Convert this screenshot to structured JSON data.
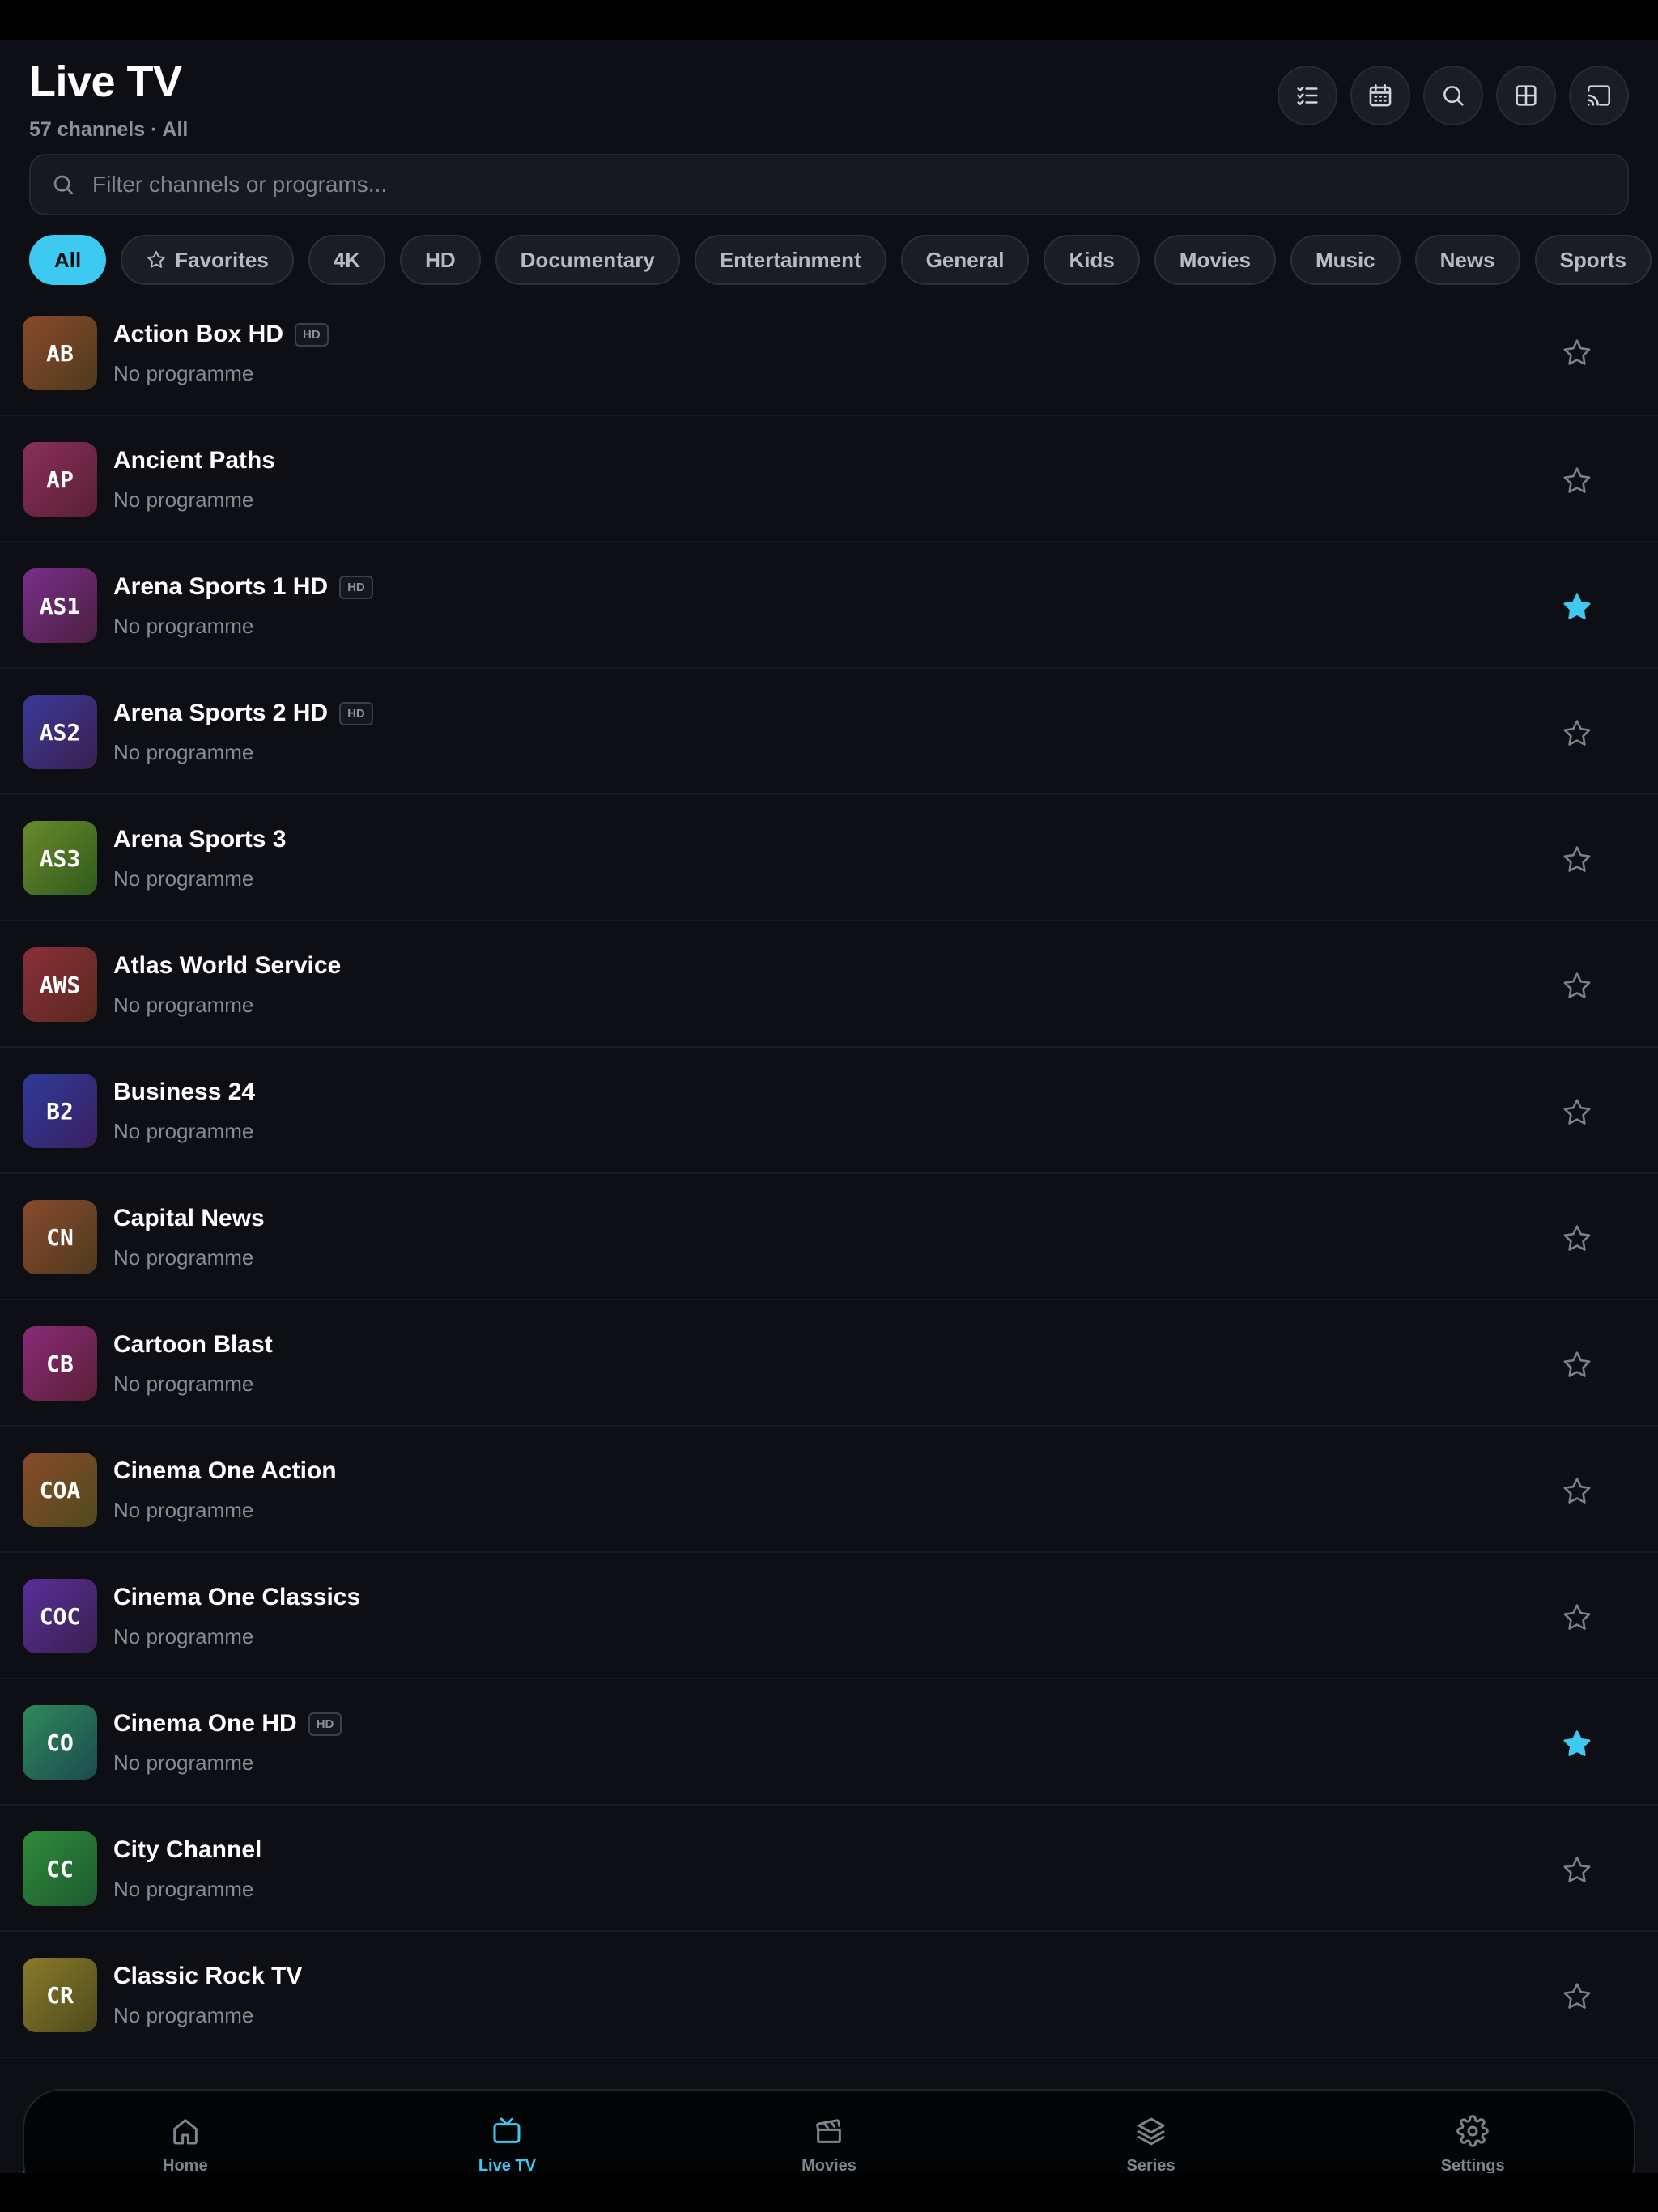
{
  "header": {
    "title": "Live TV",
    "subtitle": "57 channels · All"
  },
  "toolbar": [
    {
      "icon": "checklist-icon"
    },
    {
      "icon": "calendar-icon"
    },
    {
      "icon": "search-icon"
    },
    {
      "icon": "grid-icon"
    },
    {
      "icon": "cast-icon"
    }
  ],
  "search": {
    "placeholder": "Filter channels or programs...",
    "value": ""
  },
  "filters": [
    "All",
    "Favorites",
    "4K",
    "HD",
    "Documentary",
    "Entertainment",
    "General",
    "Kids",
    "Movies",
    "Music",
    "News",
    "Sports"
  ],
  "active_filter": "All",
  "channels": [
    {
      "abbr": "AB",
      "name": "Action Box HD",
      "badge": "HD",
      "program": "No programme",
      "favorite": false,
      "colors": [
        "#8a4a2a",
        "#4e3a1d"
      ]
    },
    {
      "abbr": "AP",
      "name": "Ancient Paths",
      "badge": "",
      "program": "No programme",
      "favorite": false,
      "colors": [
        "#8a2f5a",
        "#5a2034"
      ]
    },
    {
      "abbr": "AS1",
      "name": "Arena Sports 1 HD",
      "badge": "HD",
      "program": "No programme",
      "favorite": true,
      "colors": [
        "#7a2e8a",
        "#4a2040"
      ]
    },
    {
      "abbr": "AS2",
      "name": "Arena Sports 2 HD",
      "badge": "HD",
      "program": "No programme",
      "favorite": false,
      "colors": [
        "#3a3a9a",
        "#3a2050"
      ]
    },
    {
      "abbr": "AS3",
      "name": "Arena Sports 3",
      "badge": "",
      "program": "No programme",
      "favorite": false,
      "colors": [
        "#6a8a2a",
        "#2e5a1d"
      ]
    },
    {
      "abbr": "AWS",
      "name": "Atlas World Service",
      "badge": "",
      "program": "No programme",
      "favorite": false,
      "colors": [
        "#8a2e3a",
        "#5a2a1d"
      ]
    },
    {
      "abbr": "B2",
      "name": "Business 24",
      "badge": "",
      "program": "No programme",
      "favorite": false,
      "colors": [
        "#2e3a9a",
        "#3a2060"
      ]
    },
    {
      "abbr": "CN",
      "name": "Capital News",
      "badge": "",
      "program": "No programme",
      "favorite": false,
      "colors": [
        "#8a4a2e",
        "#4e3a1d"
      ]
    },
    {
      "abbr": "CB",
      "name": "Cartoon Blast",
      "badge": "",
      "program": "No programme",
      "favorite": false,
      "colors": [
        "#8a2a7a",
        "#5a2034"
      ]
    },
    {
      "abbr": "COA",
      "name": "Cinema One Action",
      "badge": "",
      "program": "No programme",
      "favorite": false,
      "colors": [
        "#8a4a2a",
        "#4e4a1d"
      ]
    },
    {
      "abbr": "COC",
      "name": "Cinema One Classics",
      "badge": "",
      "program": "No programme",
      "favorite": false,
      "colors": [
        "#5a2e9a",
        "#3a2050"
      ]
    },
    {
      "abbr": "CO",
      "name": "Cinema One HD",
      "badge": "HD",
      "program": "No programme",
      "favorite": true,
      "colors": [
        "#2e8a5a",
        "#1d4a4e"
      ]
    },
    {
      "abbr": "CC",
      "name": "City Channel",
      "badge": "",
      "program": "No programme",
      "favorite": false,
      "colors": [
        "#2e8a3a",
        "#1d5a2e"
      ]
    },
    {
      "abbr": "CR",
      "name": "Classic Rock TV",
      "badge": "",
      "program": "No programme",
      "favorite": false,
      "colors": [
        "#8a7a2a",
        "#4e4a1d"
      ]
    }
  ],
  "nav": [
    {
      "label": "Home",
      "icon": "home-icon",
      "active": false
    },
    {
      "label": "Live TV",
      "icon": "tv-icon",
      "active": true
    },
    {
      "label": "Movies",
      "icon": "clapperboard-icon",
      "active": false
    },
    {
      "label": "Series",
      "icon": "layers-icon",
      "active": false
    },
    {
      "label": "Settings",
      "icon": "gear-icon",
      "active": false
    }
  ],
  "accent_color": "#3ec9f0"
}
